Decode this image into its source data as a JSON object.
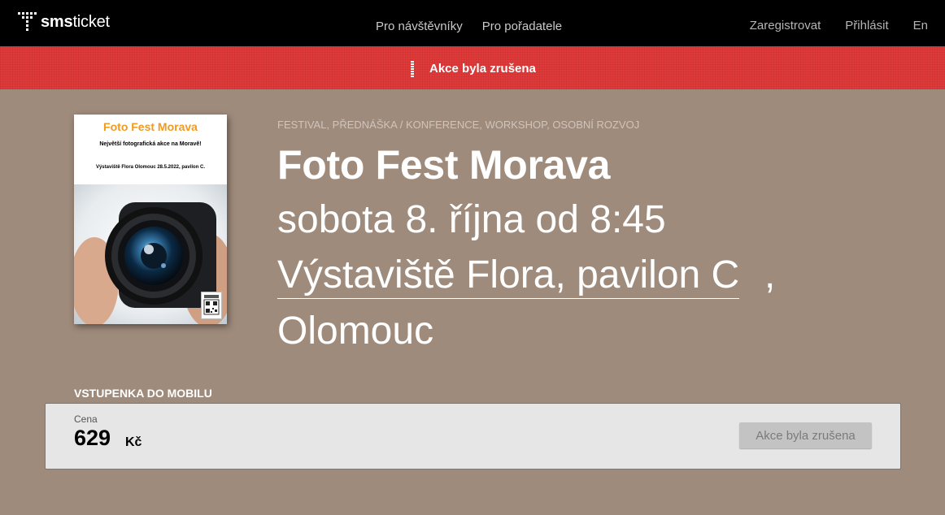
{
  "nav": {
    "logo_bold": "sms",
    "logo_regular": "ticket",
    "center_links": [
      "Pro návštěvníky",
      "Pro pořadatele"
    ],
    "register": "Zaregistrovat",
    "login": "Přihlásit",
    "language": "En"
  },
  "banner": {
    "text": "Akce byla zrušena",
    "color": "#e03a3a"
  },
  "poster": {
    "title": "Foto Fest Morava",
    "subtitle": "Největší fotografická akce na Moravě!",
    "place": "Výstaviště Flora Olomouc 28.5.2022, pavilon C."
  },
  "event": {
    "categories": "FESTIVAL, PŘEDNÁŠKA / KONFERENCE, WORKSHOP, OSOBNÍ ROZVOJ",
    "title": "Foto Fest Morava",
    "date": "sobota 8. října od 8:45",
    "venue": "Výstaviště Flora, pavilon C",
    "venue_separator": ",",
    "city": "Olomouc"
  },
  "ticket": {
    "heading": "VSTUPENKA DO MOBILU",
    "price_label": "Cena",
    "price": "629",
    "currency": "Kč",
    "button_label": "Akce byla zrušena"
  },
  "colors": {
    "page_background": "#9f8b7c",
    "topbar": "#000000",
    "poster_title": "#f29a1f"
  }
}
